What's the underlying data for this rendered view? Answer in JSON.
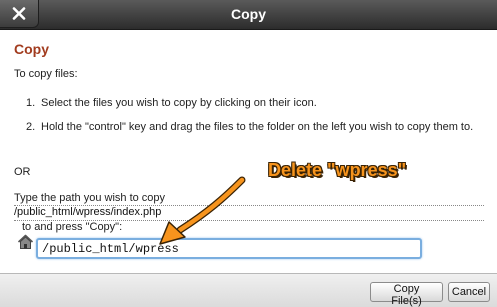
{
  "window": {
    "title": "Copy"
  },
  "content": {
    "heading": "Copy",
    "intro": "To copy files:",
    "steps": [
      {
        "number": "1.",
        "text": "Select the files you wish to copy by clicking on their icon."
      },
      {
        "number": "2.",
        "text": "Hold the \"control\" key and drag the files to the folder on the left you wish to copy them to."
      }
    ],
    "or_label": "OR",
    "path_label": "Type the path you wish to copy",
    "source_path": "/public_html/wpress/index.php",
    "press_label": "to and press \"Copy\":",
    "destination_value": "/public_html/wpress"
  },
  "annotation": {
    "text": "Delete \"wpress\"",
    "color": "#f7941d"
  },
  "footer": {
    "copy_label": "Copy File(s)",
    "cancel_label": "Cancel"
  },
  "icons": {
    "close": "close-icon",
    "home": "home-icon"
  },
  "colors": {
    "heading": "#a23c1f",
    "titlebar": "#3a3a3a",
    "input_focus": "#7aaedf"
  }
}
